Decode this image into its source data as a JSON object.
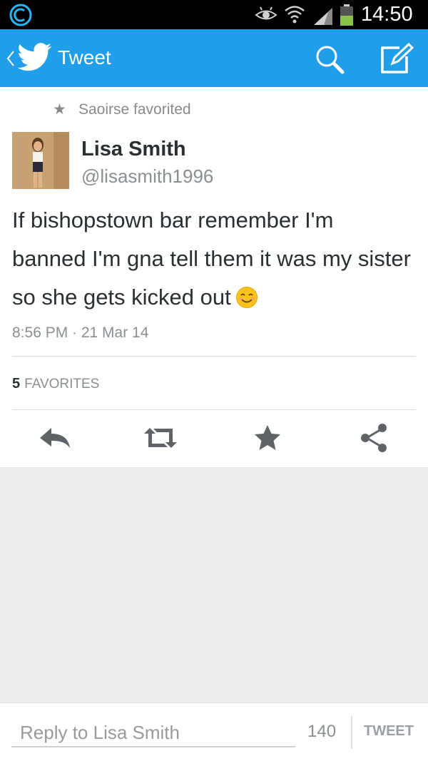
{
  "status_bar": {
    "time": "14:50",
    "icons": [
      "app-circle-icon",
      "eye-icon",
      "wifi-icon",
      "signal-icon",
      "battery-icon"
    ]
  },
  "header": {
    "title": "Tweet",
    "icons": [
      "back-chevron-icon",
      "twitter-bird-icon",
      "search-icon",
      "compose-icon"
    ]
  },
  "tweet": {
    "favorited_by": "Saoirse favorited",
    "author_name": "Lisa Smith",
    "author_handle": "@lisasmith1996",
    "text": "If bishopstown bar remember I'm banned I'm gna tell them it was my sister so she gets kicked out",
    "emoji": "smiling-face-icon",
    "timestamp": "8:56 PM · 21 Mar 14",
    "favorites_count": "5",
    "favorites_label": "FAVORITES",
    "actions": [
      "reply-icon",
      "retweet-icon",
      "favorite-icon",
      "share-icon"
    ]
  },
  "reply": {
    "placeholder": "Reply to Lisa Smith",
    "char_count": "140",
    "button_label": "TWEET"
  },
  "colors": {
    "accent": "#209ee9",
    "text": "#292f33",
    "muted": "#8a8f93",
    "background": "#ececec"
  }
}
